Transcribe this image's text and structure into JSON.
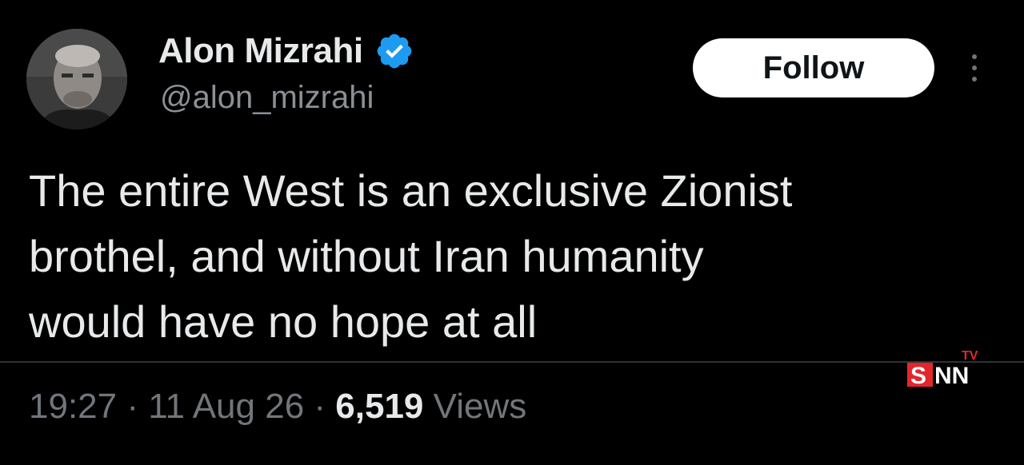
{
  "tweet": {
    "author": {
      "display_name": "Alon Mizrahi",
      "handle": "@alon_mizrahi",
      "verified": true,
      "avatar_icon": "profile-photo"
    },
    "follow_label": "Follow",
    "more_icon": "more-vertical-icon",
    "text_lines": [
      "The entire West is an exclusive Zionist",
      "brothel, and without Iran humanity",
      "would have no hope at all"
    ],
    "time": "19:27",
    "separator": "·",
    "date": "11 Aug 26",
    "views_count": "6,519",
    "views_label": "Views"
  },
  "watermark": {
    "brand": "SNN",
    "suffix": "TV",
    "accent_color": "#e3262c"
  },
  "colors": {
    "background": "#000000",
    "primary_text": "#e7e9ea",
    "secondary_text": "#71767b",
    "verified_badge": "#1d9bf0",
    "follow_button_bg": "#ffffff"
  }
}
